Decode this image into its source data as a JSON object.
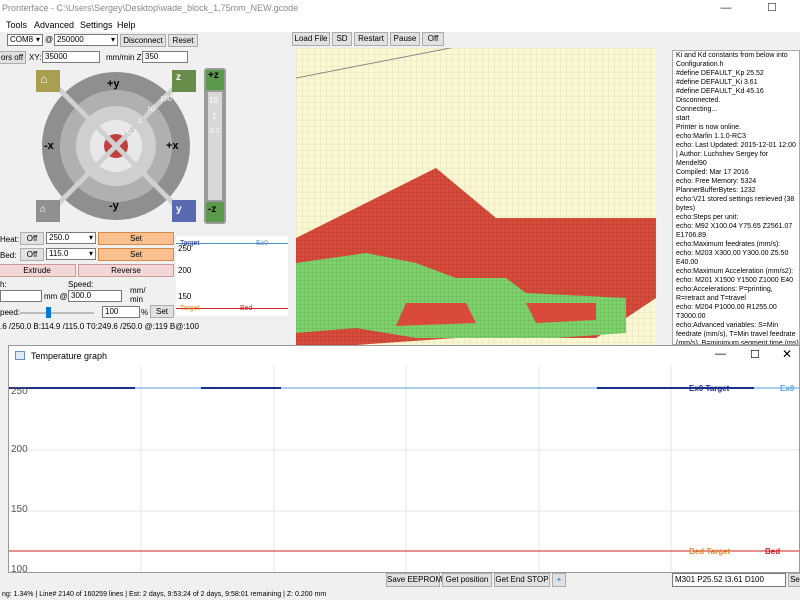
{
  "title": "Pronterface - C:\\Users\\Sergey\\Desktop\\wade_block_1,75mm_NEW.gcode",
  "menu": [
    "Tools",
    "Advanced",
    "Settings",
    "Help"
  ],
  "connection": {
    "port": "COM8",
    "at": "@",
    "baud": "250000",
    "disconnect": "Disconnect",
    "reset": "Reset"
  },
  "motors_off": "ors off",
  "feedrate": {
    "xy_label": "XY:",
    "xy_value": "35000",
    "z_label": "mm/min Z:",
    "z_value": "350"
  },
  "jog": {
    "home": "⌂",
    "y_plus": "+y",
    "y_minus": "-y",
    "x_plus": "+x",
    "x_minus": "-x",
    "z_plus": "+z",
    "z_minus": "-z",
    "z_home": "z",
    "y_home": "y",
    "x_home": "x",
    "steps": [
      "100",
      "10",
      "1",
      "0.1"
    ],
    "z_steps": [
      "10",
      "1",
      "0.1"
    ]
  },
  "heat": {
    "heat_label": "Heat:",
    "heat_off": "Off",
    "heat_value": "250.0",
    "heat_set": "Set",
    "bed_label": "Bed:",
    "bed_off": "Off",
    "bed_value": "115.0",
    "bed_set": "Set"
  },
  "extrude": "Extrude",
  "reverse": "Reverse",
  "length_label": "h:",
  "length_value": "",
  "mm_at": "mm @",
  "speed_label": "Speed:",
  "speed_value": "300.0",
  "speed_unit": "mm/\nmin",
  "print_speed_label": "peed:",
  "print_speed_value": "100",
  "percent": "%",
  "print_speed_set": "Set",
  "temp_status": ".6 /250.0 B:114.9 /115.0 T0:249.6 /250.0 @:119 B@:100",
  "minigraph": {
    "ylabels": [
      "250",
      "200",
      "150"
    ],
    "ex_target": "Target",
    "ex0": "Ex0",
    "bed_target": "Target",
    "bed": "Bed"
  },
  "toolbar": [
    "Load File",
    "SD",
    "Restart",
    "Pause",
    "Off"
  ],
  "log": [
    "Ki and Kd constants from below into",
    "Configuration.h",
    "#define  DEFAULT_Kp 25.52",
    "#define  DEFAULT_Ki 3.61",
    "#define  DEFAULT_Kd 45.16",
    "Disconnected.",
    "Connecting...",
    "start",
    "Printer is now online.",
    "echo:Marlin 1.1.0-RC3",
    "echo: Last Updated: 2015-12-01 12:00",
    "| Author: Luchshev Sergey for",
    "Mendel90",
    "Compiled: Mar 17 2016",
    "echo: Free Memory: 5324",
    "PlannerBufferBytes: 1232",
    "echo:V21 stored settings retrieved (38",
    "bytes)",
    "echo:Steps per unit:",
    "echo:  M92 X100.04 Y75.65 Z2561.07",
    "E1706.89",
    "echo:Maximum feedrates (mm/s):",
    "echo:  M203 X300.00 Y300.00 Z5.50",
    "E40.00",
    "echo:Maximum Acceleration (mm/s2):",
    "echo:  M201 X1500 Y1500 Z1000 E40",
    "echo:Accelerations: P=printing,",
    "R=retract and T=travel",
    "echo:  M204 P1000.00 R1255.00",
    "T3000.00",
    "echo:Advanced variables: S=Min",
    "feedrate (mm/s), T=Min travel feedrate",
    "(mm/s), B=minimum segment time (ms),",
    "X=maximum XY jerk (mm/s)"
  ],
  "temp_window": {
    "title": "Temperature graph",
    "ylabels": [
      "250",
      "200",
      "150",
      "100"
    ],
    "ex0_target": "Ex0 Target",
    "ex0": "Ex0",
    "bed_target": "Bed Target",
    "bed": "Bed",
    "colors": {
      "ex0_target": "#1a2f8f",
      "ex0": "#5aa0e0",
      "bed_target": "#e08a3a",
      "bed": "#d02020"
    }
  },
  "bottom": {
    "save_eeprom": "Save EEPROM",
    "get_position": "Get position",
    "get_end_stop": "Get End STOP",
    "plus": "+",
    "command": "M301 P25.52 I3.61 D100",
    "send": "Se"
  },
  "status": "ng: 1.34% | Line# 2140 of 160259 lines | Est: 2 days, 9:53:24 of 2 days, 9:58:01 remaining |  Z: 0.200 mm"
}
